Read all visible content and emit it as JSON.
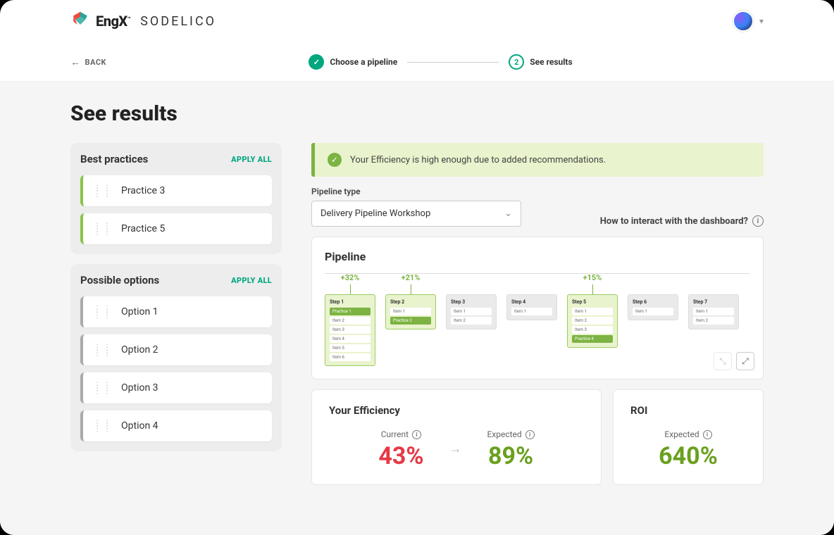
{
  "header": {
    "brand_primary": "EngX",
    "brand_tm": "™",
    "brand_secondary": "SODELICO"
  },
  "stepper": {
    "back_label": "BACK",
    "step1_label": "Choose a pipeline",
    "step2_number": "2",
    "step2_label": "See results"
  },
  "page": {
    "title": "See results"
  },
  "best_practices": {
    "title": "Best practices",
    "apply_all": "APPLY ALL",
    "items": [
      {
        "label": "Practice 3"
      },
      {
        "label": "Practice 5"
      }
    ]
  },
  "possible_options": {
    "title": "Possible options",
    "apply_all": "APPLY ALL",
    "items": [
      {
        "label": "Option 1"
      },
      {
        "label": "Option 2"
      },
      {
        "label": "Option 3"
      },
      {
        "label": "Option 4"
      }
    ]
  },
  "alert": {
    "text": "Your Efficiency is high enough due to added recommendations."
  },
  "pipeline_type": {
    "label": "Pipeline type",
    "value": "Delivery Pipeline Workshop"
  },
  "help_link": "How to interact with the dashboard?",
  "pipeline": {
    "title": "Pipeline",
    "steps": [
      {
        "name": "Step 1",
        "pct": "+32%",
        "highlight": true,
        "items": [
          "Practice 1",
          "Item 2",
          "Item 3",
          "Item 4",
          "Item 5",
          "Item 6"
        ],
        "accent_idx": 0
      },
      {
        "name": "Step 2",
        "pct": "+21%",
        "highlight": true,
        "items": [
          "Item 1",
          "Practice 2"
        ],
        "accent_idx": 1
      },
      {
        "name": "Step 3",
        "pct": "",
        "highlight": false,
        "items": [
          "Item 1",
          "Item 2"
        ],
        "accent_idx": -1
      },
      {
        "name": "Step 4",
        "pct": "",
        "highlight": false,
        "items": [
          "Item 1"
        ],
        "accent_idx": -1
      },
      {
        "name": "Step 5",
        "pct": "+15%",
        "highlight": true,
        "items": [
          "Item 1",
          "Item 2",
          "Item 3",
          "Practice 4"
        ],
        "accent_idx": 3
      },
      {
        "name": "Step 6",
        "pct": "",
        "highlight": false,
        "items": [
          "Item 1"
        ],
        "accent_idx": -1
      },
      {
        "name": "Step 7",
        "pct": "",
        "highlight": false,
        "items": [
          "Item 1",
          "Item 2"
        ],
        "accent_idx": -1
      }
    ]
  },
  "efficiency": {
    "title": "Your Efficiency",
    "current_label": "Current",
    "current_value": "43%",
    "expected_label": "Expected",
    "expected_value": "89%"
  },
  "roi": {
    "title": "ROI",
    "expected_label": "Expected",
    "expected_value": "640%"
  }
}
